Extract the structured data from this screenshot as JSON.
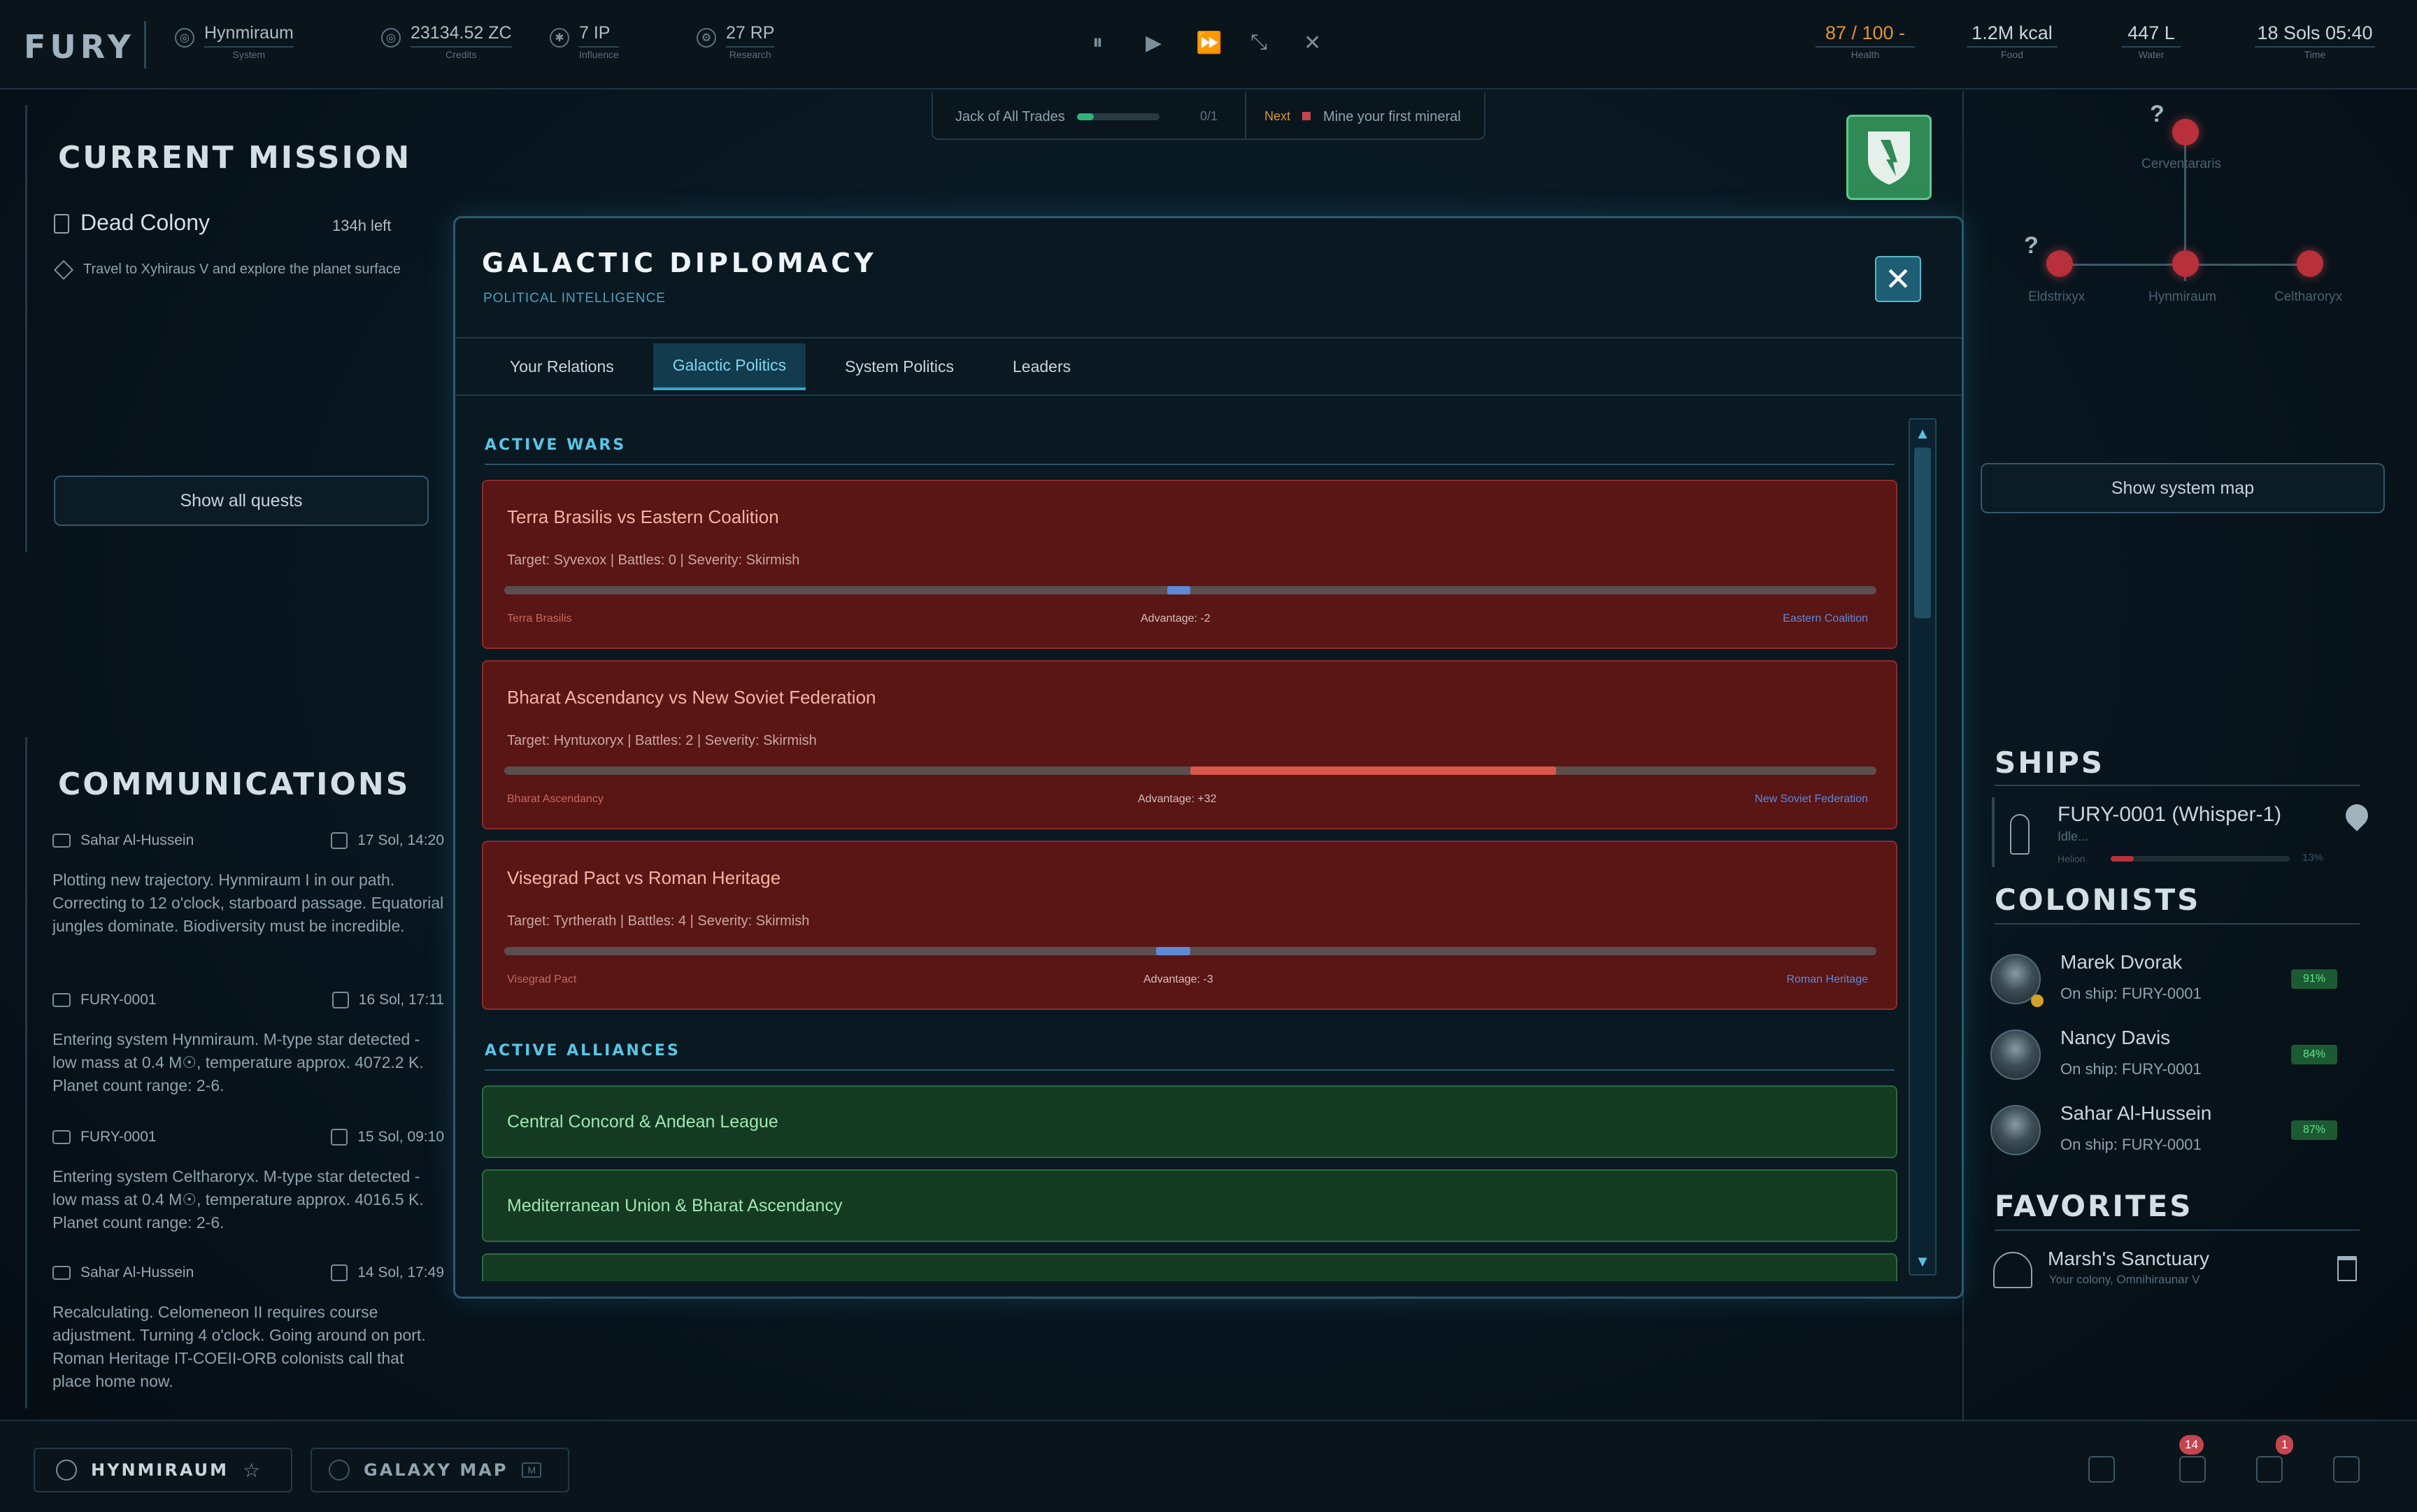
{
  "app": {
    "logo": "FURY"
  },
  "topbar": {
    "system": {
      "value": "Hynmiraum",
      "label": "System"
    },
    "credits": {
      "value": "23134.52 ZC",
      "label": "Credits"
    },
    "influence": {
      "value": "7 IP",
      "label": "Influence"
    },
    "research": {
      "value": "27 RP",
      "label": "Research"
    },
    "controls": {
      "pause": "⏸",
      "play": "▶",
      "fast": "⏩",
      "faster": "⤡",
      "fastest": "✕"
    },
    "health": {
      "value": "87 / 100 -",
      "label": "Health"
    },
    "food": {
      "value": "1.2M kcal",
      "label": "Food"
    },
    "water": {
      "value": "447 L",
      "label": "Water"
    },
    "time": {
      "value": "18 Sols 05:40",
      "label": "Time"
    }
  },
  "achievement": {
    "name": "Jack of All Trades",
    "progress_text": "0/1",
    "progress": 0.2,
    "next_label": "Next",
    "next_task": "Mine your first mineral"
  },
  "mission": {
    "title": "CURRENT MISSION",
    "name": "Dead Colony",
    "time_left": "134h left",
    "objective": "Travel to Xyhiraus V and explore the planet surface",
    "show_all": "Show all quests"
  },
  "communications": {
    "title": "COMMUNICATIONS",
    "messages": [
      {
        "sender": "Sahar Al-Hussein",
        "date": "17 Sol, 14:20",
        "text": "Plotting new trajectory. Hynmiraum I in our path. Correcting to 12 o'clock, starboard passage. Equatorial jungles dominate. Biodiversity must be incredible."
      },
      {
        "sender": "FURY-0001",
        "date": "16 Sol, 17:11",
        "text": "Entering system Hynmiraum. M-type star detected - low mass at 0.4 M☉, temperature approx. 4072.2 K. Planet count range: 2-6."
      },
      {
        "sender": "FURY-0001",
        "date": "15 Sol, 09:10",
        "text": "Entering system Celtharoryx. M-type star detected - low mass at 0.4 M☉, temperature approx. 4016.5 K. Planet count range: 2-6."
      },
      {
        "sender": "Sahar Al-Hussein",
        "date": "14 Sol, 17:49",
        "text": "Recalculating. Celomeneon II requires course adjustment. Turning 4 o'clock. Going around on port. Roman Heritage IT-COEII-ORB colonists call that place home now."
      }
    ]
  },
  "modal": {
    "title": "GALACTIC DIPLOMACY",
    "subtitle": "POLITICAL INTELLIGENCE",
    "close": "✕",
    "tabs": [
      {
        "label": "Your Relations",
        "active": false
      },
      {
        "label": "Galactic Politics",
        "active": true
      },
      {
        "label": "System Politics",
        "active": false
      },
      {
        "label": "Leaders",
        "active": false
      }
    ],
    "wars_title": "ACTIVE WARS",
    "wars": [
      {
        "title": "Terra Brasilis vs Eastern Coalition",
        "details": "Target: Syvexox | Battles: 0 | Severity: Skirmish",
        "left": "Terra Brasilis",
        "right": "Eastern Coalition",
        "advantage_label": "Advantage: -2",
        "advantage": -2
      },
      {
        "title": "Bharat Ascendancy vs New Soviet Federation",
        "details": "Target: Hyntuxoryx | Battles: 2 | Severity: Skirmish",
        "left": "Bharat Ascendancy",
        "right": "New Soviet Federation",
        "advantage_label": "Advantage: +32",
        "advantage": 32
      },
      {
        "title": "Visegrad Pact vs Roman Heritage",
        "details": "Target: Tyrtherath | Battles: 4 | Severity: Skirmish",
        "left": "Visegrad Pact",
        "right": "Roman Heritage",
        "advantage_label": "Advantage: -3",
        "advantage": -3
      }
    ],
    "alliances_title": "ACTIVE ALLIANCES",
    "alliances": [
      "Central Concord & Andean League",
      "Mediterranean Union & Bharat Ascendancy"
    ],
    "scroll": {
      "up": "▲",
      "down": "▼"
    }
  },
  "system_map": {
    "unknown": "?",
    "nodes": [
      "Cerventararis",
      "Eldstrixyx",
      "Hynmiraum",
      "Celtharoryx"
    ],
    "show_button": "Show system map"
  },
  "ships": {
    "title": "SHIPS",
    "items": [
      {
        "name": "FURY-0001 (Whisper-1)",
        "status": "Idle...",
        "fuel_label": "Helion",
        "fuel": "13%",
        "fuel_value": 0.13
      }
    ]
  },
  "colonists": {
    "title": "COLONISTS",
    "items": [
      {
        "name": "Marek Dvorak",
        "location": "On ship: FURY-0001",
        "health": "91%"
      },
      {
        "name": "Nancy Davis",
        "location": "On ship: FURY-0001",
        "health": "84%"
      },
      {
        "name": "Sahar Al-Hussein",
        "location": "On ship: FURY-0001",
        "health": "87%"
      }
    ]
  },
  "favorites": {
    "title": "FAVORITES",
    "items": [
      {
        "name": "Marsh's Sanctuary",
        "detail": "Your colony, Omnihiraunar V"
      }
    ]
  },
  "bottombar": {
    "location": "HYNMIRAUM",
    "galaxy_map": "GALAXY MAP",
    "galaxy_key": "M",
    "badges": [
      "14",
      "1"
    ]
  },
  "colors": {
    "accent": "#3aa5c9",
    "war_bg": "#5a1515",
    "alliance_bg": "#143b22",
    "node": "#b7303a",
    "health": "#e0952f"
  }
}
